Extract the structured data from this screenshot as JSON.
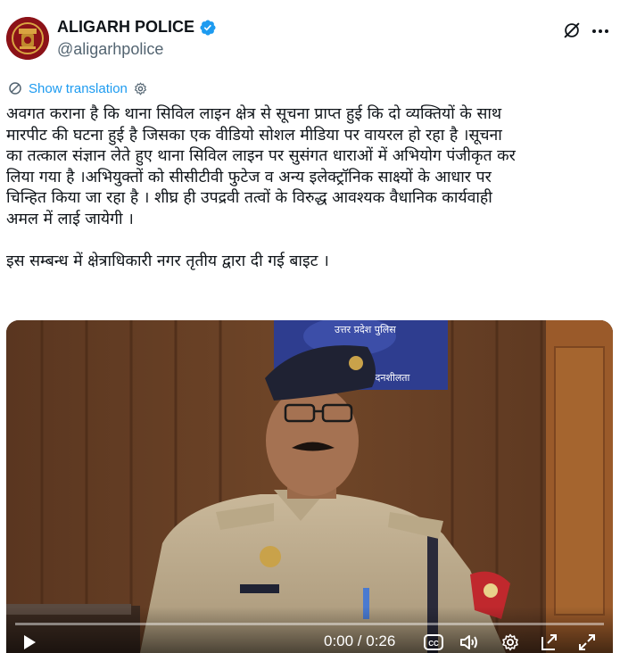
{
  "account": {
    "display_name": "ALIGARH POLICE",
    "handle": "@aligarhpolice",
    "verified": true
  },
  "translation": {
    "label": "Show translation"
  },
  "tweet": {
    "lines": [
      "अवगत कराना है कि थाना सिविल लाइन क्षेत्र से सूचना प्राप्त हुई कि दो व्यक्तियों के साथ",
      "मारपीट की घटना हुई है जिसका एक वीडियो सोशल मीडिया पर वायरल हो रहा है ।सूचना",
      "का तत्काल संज्ञान लेते हुए थाना सिविल लाइन पर सुसंगत धाराओं में अभियोग पंजीकृत कर",
      "लिया गया है ।अभियुक्तों को सीसीटीवी फुटेज व अन्य इलेक्ट्रॉनिक साक्ष्यों के आधार पर",
      "चिन्हित किया जा रहा है । शीघ्र ही उपद्रवी तत्वों के विरुद्ध आवश्यक वैधानिक कार्यवाही",
      "अमल में लाई जायेगी ।"
    ],
    "second_paragraph": "इस सम्बन्ध में क्षेत्राधिकारी नगर तृतीय द्वारा दी गई बाइट ।"
  },
  "video": {
    "banner_text_top": "उत्तर प्रदेश पुलिस",
    "banner_text_bottom": "संवेदनशीलता",
    "time": "0:00 / 0:26",
    "progress": 0,
    "icons": [
      "play-icon",
      "captions-icon",
      "volume-icon",
      "settings-icon",
      "popout-icon",
      "fullscreen-icon"
    ]
  },
  "colors": {
    "link": "#1d9bf0",
    "verified": "#1d9bf0",
    "secondary_text": "#536471",
    "primary_text": "#0f1419"
  }
}
